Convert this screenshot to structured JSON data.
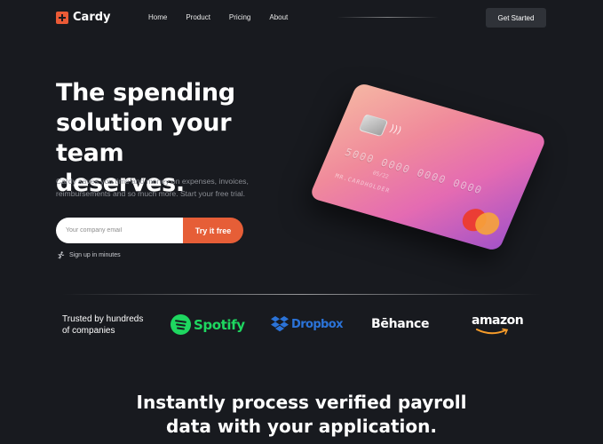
{
  "header": {
    "logo_text": "Cardy",
    "nav": [
      "Home",
      "Product",
      "Pricing",
      "About"
    ],
    "cta_label": "Get Started"
  },
  "hero": {
    "title_line1": "The spending",
    "title_line2": "solution your team",
    "title_line3": "deserves.",
    "subtitle_line1": "Cardy saves you time and money on expenses, invoices,",
    "subtitle_line2": "reimbursements and so much more. Start your free trial.",
    "email_placeholder": "Your company email",
    "try_label": "Try it free",
    "note": "Sign up in minutes"
  },
  "card": {
    "number": "5000 0000 0000 0000",
    "expiry": "05/22",
    "holder": "MR.CARDHOLDER",
    "contactless_icon": "contactless-icon",
    "network_logo": "mastercard-logo"
  },
  "trusted": {
    "label_line1": "Trusted by hundreds",
    "label_line2": "of companies",
    "brands": [
      "Spotify",
      "Dropbox",
      "Bēhance",
      "amazon"
    ]
  },
  "section": {
    "heading_line1": "Instantly process verified payroll",
    "heading_line2": "data with your application."
  },
  "colors": {
    "background": "#181a1f",
    "accent": "#e65e37",
    "spotify": "#1ed760",
    "dropbox": "#2b73d8"
  }
}
